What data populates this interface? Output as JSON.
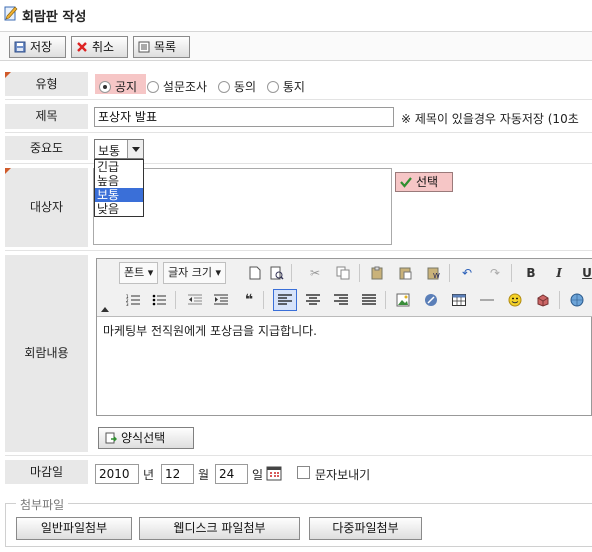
{
  "page_title": "회람판 작성",
  "toolbar": {
    "save": "저장",
    "cancel": "취소",
    "list": "목록"
  },
  "type": {
    "label": "유형",
    "options": [
      "공지",
      "설문조사",
      "동의",
      "통지"
    ],
    "selected": "공지"
  },
  "subject": {
    "label": "제목",
    "value": "포상자 발표",
    "note": "※ 제목이 있을경우 자동저장 (10초"
  },
  "importance": {
    "label": "중요도",
    "value": "보통",
    "options": [
      "긴급",
      "높음",
      "보통",
      "낮음"
    ],
    "highlighted": "보통"
  },
  "target": {
    "label": "대상자",
    "select_button": "선택"
  },
  "content": {
    "label": "회람내용",
    "font_label": "폰트",
    "size_label": "글자 크기",
    "body_text": "마케팅부 전직원에게 포상금을 지급합니다.",
    "template_button": "양식선택"
  },
  "deadline": {
    "label": "마감일",
    "year": "2010",
    "year_unit": "년",
    "month": "12",
    "month_unit": "월",
    "day": "24",
    "day_unit": "일",
    "sms_label": "문자보내기"
  },
  "attachments": {
    "legend": "첨부파일",
    "buttons": [
      "일반파일첨부",
      "웹디스크 파일첨부",
      "다중파일첨부"
    ]
  },
  "colors": {
    "label_bg": "#e8e8e8",
    "highlight_red": "#f6c6c6",
    "selected_blue": "#3a6fd8",
    "accent": "#d05a2a"
  }
}
